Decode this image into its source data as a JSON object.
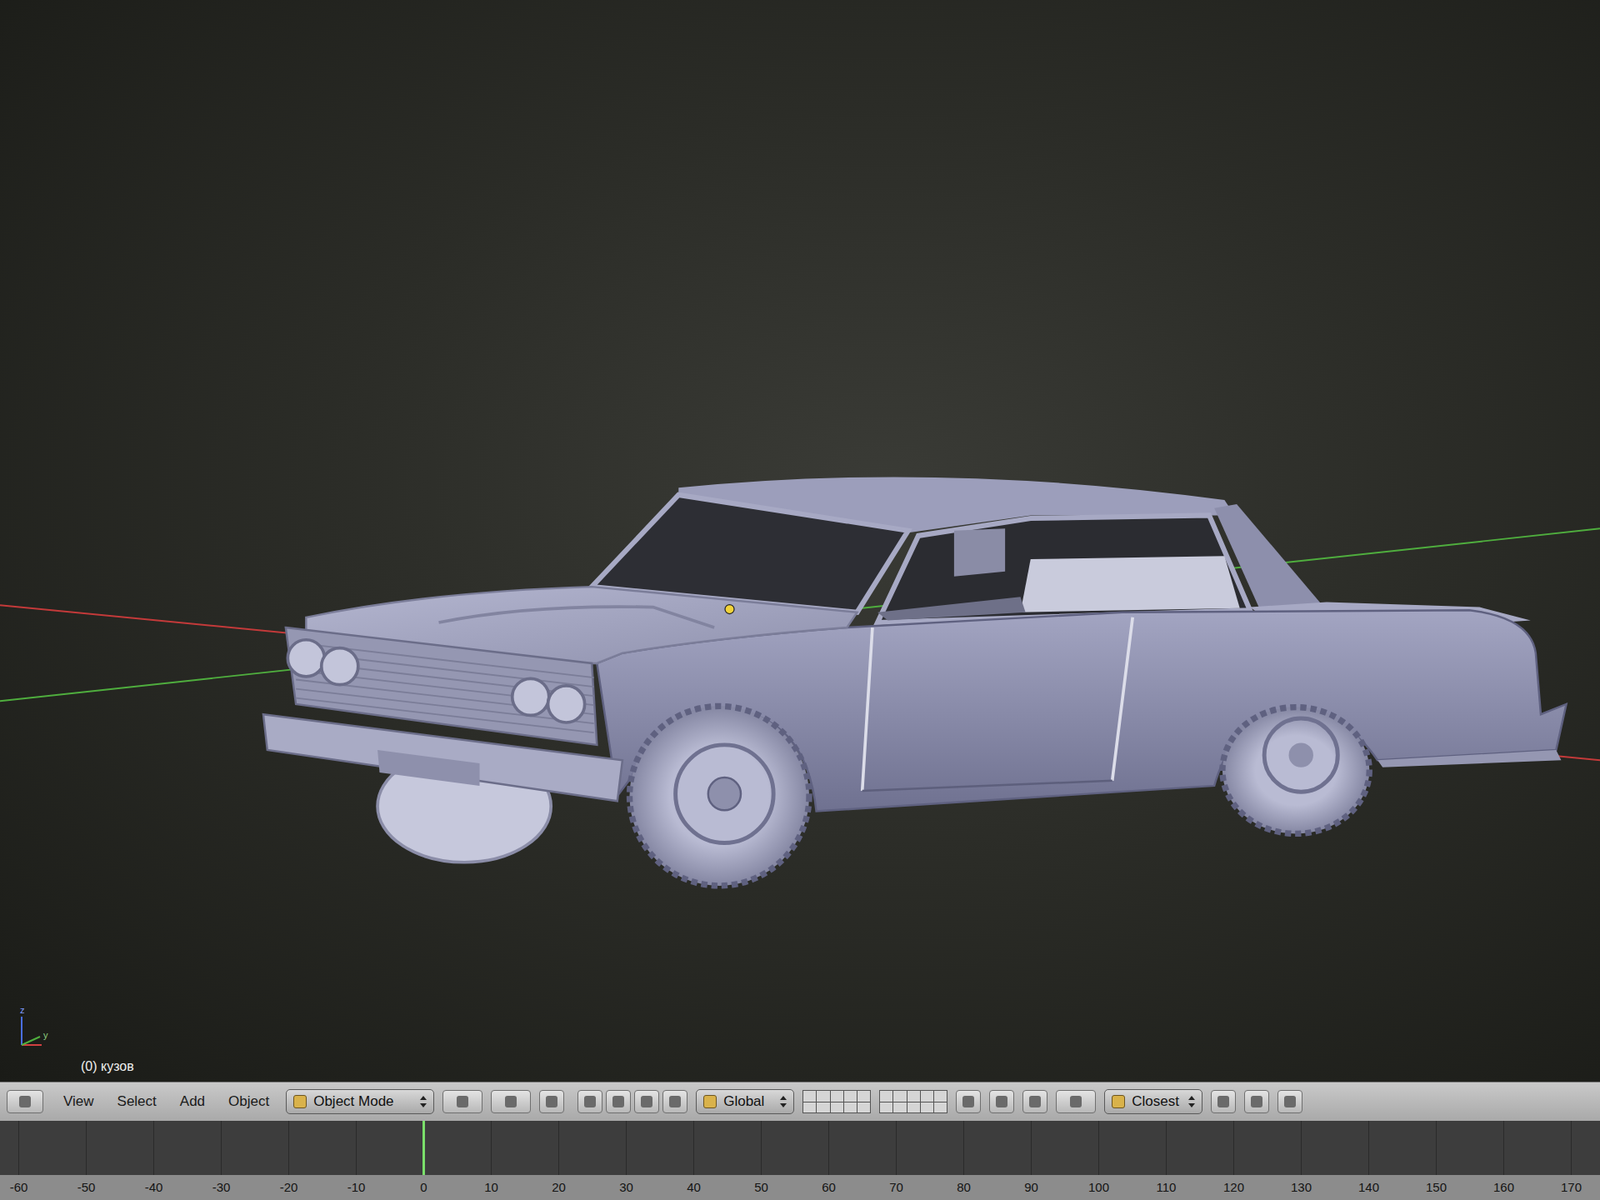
{
  "viewport": {
    "object_label": "(0) кузов",
    "axis_gizmo": [
      "z",
      "y"
    ]
  },
  "header": {
    "menus": [
      "View",
      "Select",
      "Add",
      "Object"
    ],
    "mode": "Object Mode",
    "orientation": "Global",
    "snap_target": "Closest"
  },
  "timeline": {
    "ticks": [
      {
        "label": "-60",
        "current": false
      },
      {
        "label": "-50",
        "current": false
      },
      {
        "label": "-40",
        "current": false
      },
      {
        "label": "-30",
        "current": false
      },
      {
        "label": "-20",
        "current": false
      },
      {
        "label": "-10",
        "current": false
      },
      {
        "label": "0",
        "current": true
      },
      {
        "label": "10",
        "current": false
      },
      {
        "label": "20",
        "current": false
      },
      {
        "label": "30",
        "current": false
      },
      {
        "label": "40",
        "current": false
      },
      {
        "label": "50",
        "current": false
      },
      {
        "label": "60",
        "current": false
      },
      {
        "label": "70",
        "current": false
      },
      {
        "label": "80",
        "current": false
      },
      {
        "label": "90",
        "current": false
      },
      {
        "label": "100",
        "current": false
      },
      {
        "label": "110",
        "current": false
      },
      {
        "label": "120",
        "current": false
      },
      {
        "label": "130",
        "current": false
      },
      {
        "label": "140",
        "current": false
      },
      {
        "label": "150",
        "current": false
      },
      {
        "label": "160",
        "current": false
      },
      {
        "label": "170",
        "current": false
      }
    ]
  }
}
